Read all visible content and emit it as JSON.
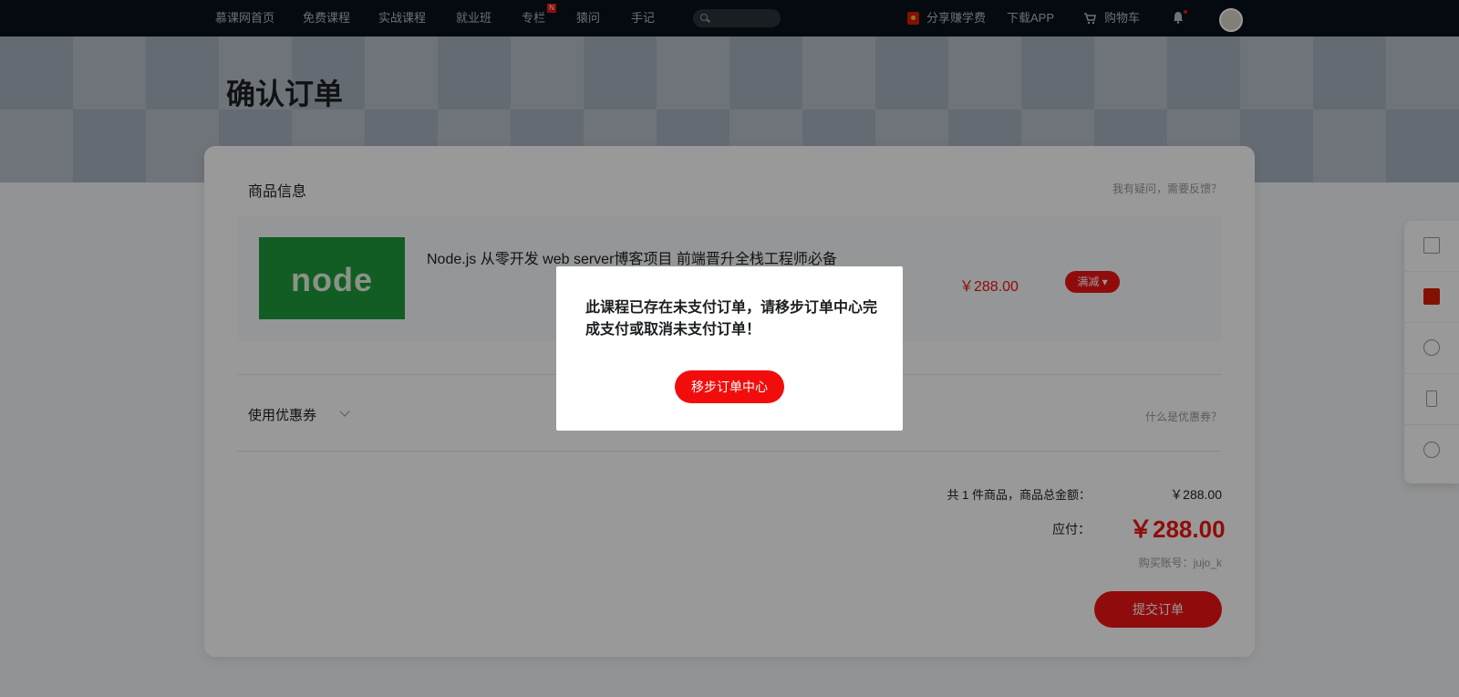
{
  "nav": {
    "items": [
      {
        "label": "慕课网首页"
      },
      {
        "label": "免费课程"
      },
      {
        "label": "实战课程"
      },
      {
        "label": "就业班"
      },
      {
        "label": "专栏"
      },
      {
        "label": "猿问"
      },
      {
        "label": "手记"
      }
    ],
    "column_badge": "N",
    "share_label": "分享赚学费",
    "download_label": "下载APP",
    "cart_label": "购物车"
  },
  "page": {
    "title": "确认订单"
  },
  "goods": {
    "section_title": "商品信息",
    "feedback_link": "我有疑问，需要反馈？",
    "product": {
      "name": "Node.js 从零开发 web server博客项目 前端晋升全栈工程师必备",
      "thumb_text": "node",
      "price": "￥288.00",
      "discount_label": "满减"
    }
  },
  "coupon": {
    "label": "使用优惠券",
    "help_link": "什么是优惠券？"
  },
  "summary": {
    "count_label": "共 1 件商品，商品总金额：",
    "total": "￥288.00",
    "pay_label": "应付：",
    "pay_amount": "￥288.00",
    "account": "购买账号：jujo_k",
    "submit_label": "提交订单"
  },
  "modal": {
    "message": "此课程已存在未支付订单，请移步订单中心完成支付或取消未支付订单！",
    "button_label": "移步订单中心"
  },
  "colors": {
    "accent": "#f01414",
    "nav_bg": "#07111b"
  }
}
